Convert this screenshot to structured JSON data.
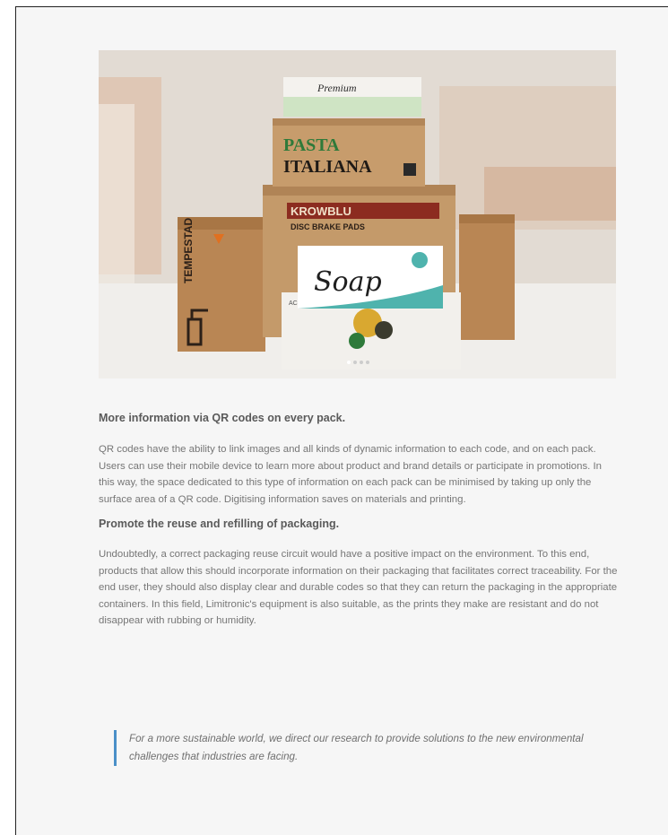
{
  "hero": {
    "box_labels": {
      "premium": "Premium",
      "pasta_1": "PASTA",
      "pasta_2": "ITALIANA",
      "brand": "KROWBLU",
      "brake": "DISC BRAKE PADS",
      "soap": "Soap",
      "tempestad": "TEMPESTAD",
      "olive": "ACEITE DE OLIVA"
    }
  },
  "article": {
    "heading_1": "More information via QR codes on every pack.",
    "paragraph_1": "QR codes have the ability to link images and all kinds of dynamic information to each code, and on each pack. Users can use their mobile device to learn more about product and brand details or participate in promotions. In this way, the space dedicated to this type of information on each pack can be minimised by taking up only the surface area of a QR code. Digitising information saves on materials and printing.",
    "heading_2": "Promote the reuse and refilling of packaging.",
    "paragraph_2": "Undoubtedly, a correct packaging reuse circuit would have a positive impact on the environment. To this end, products that allow this should incorporate information on their packaging that facilitates correct traceability. For the end user, they should also display clear and durable codes so that they can return the packaging in the appropriate containers. In this field, Limitronic's equipment is also suitable, as the prints they make are resistant and do not disappear with rubbing or humidity.",
    "quote": "For a more sustainable world, we direct our research to provide solutions to the new environmental challenges that industries are facing."
  },
  "colors": {
    "quote_border": "#4a90c8",
    "cardboard": "#c49a6a"
  }
}
